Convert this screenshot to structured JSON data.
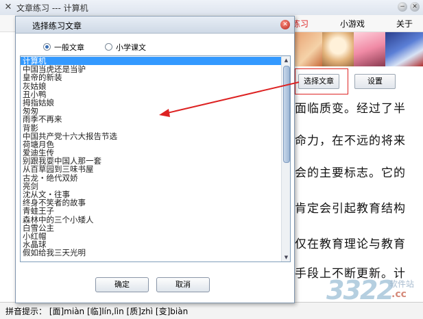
{
  "window": {
    "title": "文章练习 --- 计算机"
  },
  "menu": {
    "items": [
      "练习",
      "小游戏",
      "关于"
    ]
  },
  "toolbar": {
    "select_article": "选择文章",
    "settings": "设置"
  },
  "article": {
    "lines": [
      "面临质变。经过了半",
      "命力，在不远的将来",
      "会的主要标志。它的",
      "肯定会引起教育结构",
      "仅在教育理论与教育",
      "手段上不断更新。计"
    ]
  },
  "status": {
    "hint": "拼音提示： [面]miàn  [临]lín,lìn  [质]zhì  [变]biàn"
  },
  "dialog": {
    "title": "选择练习文章",
    "radio_general": "一般文章",
    "radio_primary": "小学课文",
    "radio_selected": "general",
    "ok": "确定",
    "cancel": "取消",
    "articles": [
      "计算机",
      "中国当虎还是当驴",
      "皇帝的新装",
      "灰姑娘",
      "丑小鸭",
      "拇指姑娘",
      "匆匆",
      "雨季不再来",
      "背影",
      "中国共产党十六大报告节选",
      "荷塘月色",
      "爱迪生传",
      "别跟我耍中国人那一套",
      "从百草园到三味书屋",
      "古龙・绝代双娇",
      "亮剑",
      "沈从文・往事",
      "终身不笑者的故事",
      "青蛙王子",
      "森林中的三个小矮人",
      "白雪公主",
      "小红帽",
      "水晶球",
      "假如给我三天光明"
    ]
  },
  "colors": {
    "selection": "#3399ff",
    "annotation": "#dd2222"
  }
}
